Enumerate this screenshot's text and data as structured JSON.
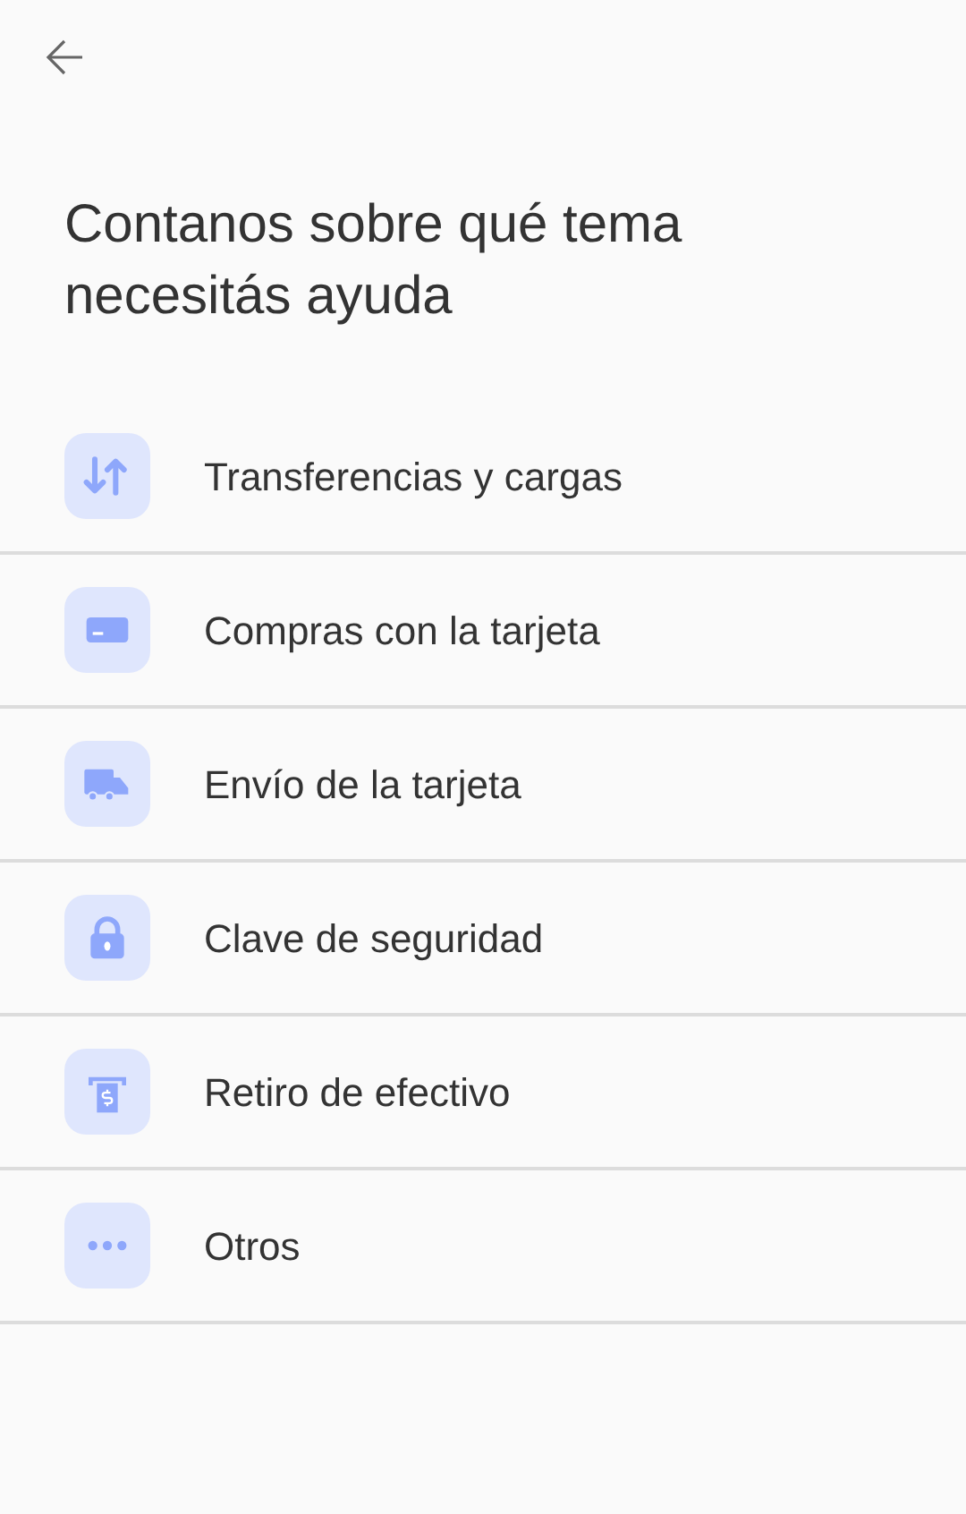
{
  "title": "Contanos sobre qué tema necesitás ayuda",
  "topics": [
    {
      "kind": "transfer",
      "label": "Transferencias y cargas"
    },
    {
      "kind": "card",
      "label": "Compras con la tarjeta"
    },
    {
      "kind": "truck",
      "label": "Envío de la tarjeta"
    },
    {
      "kind": "lock",
      "label": "Clave de seguridad"
    },
    {
      "kind": "atm",
      "label": "Retiro de efectivo"
    },
    {
      "kind": "more",
      "label": "Otros"
    }
  ]
}
